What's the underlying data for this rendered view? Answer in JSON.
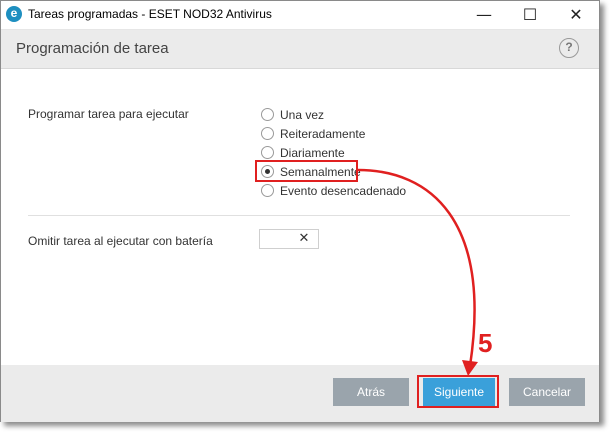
{
  "window": {
    "title": "Tareas programadas - ESET NOD32 Antivirus",
    "app_icon_letter": "e",
    "minimize_glyph": "—",
    "maximize_glyph": "☐",
    "close_glyph": "✕"
  },
  "header": {
    "title": "Programación de tarea",
    "help_glyph": "?"
  },
  "schedule": {
    "label": "Programar tarea para ejecutar",
    "options": [
      {
        "label": "Una vez",
        "selected": false
      },
      {
        "label": "Reiteradamente",
        "selected": false
      },
      {
        "label": "Diariamente",
        "selected": false
      },
      {
        "label": "Semanalmente",
        "selected": true
      },
      {
        "label": "Evento desencadenado",
        "selected": false
      }
    ]
  },
  "battery": {
    "label": "Omitir tarea al ejecutar con batería",
    "toggle_glyph": "✕",
    "enabled": false
  },
  "footer": {
    "back_label": "Atrás",
    "next_label": "Siguiente",
    "cancel_label": "Cancelar"
  },
  "annotation": {
    "step_number": "5",
    "color": "#e02020"
  },
  "colors": {
    "primary_button": "#3aa0da",
    "secondary_button": "#9aa4ac",
    "annotation": "#e02020"
  }
}
